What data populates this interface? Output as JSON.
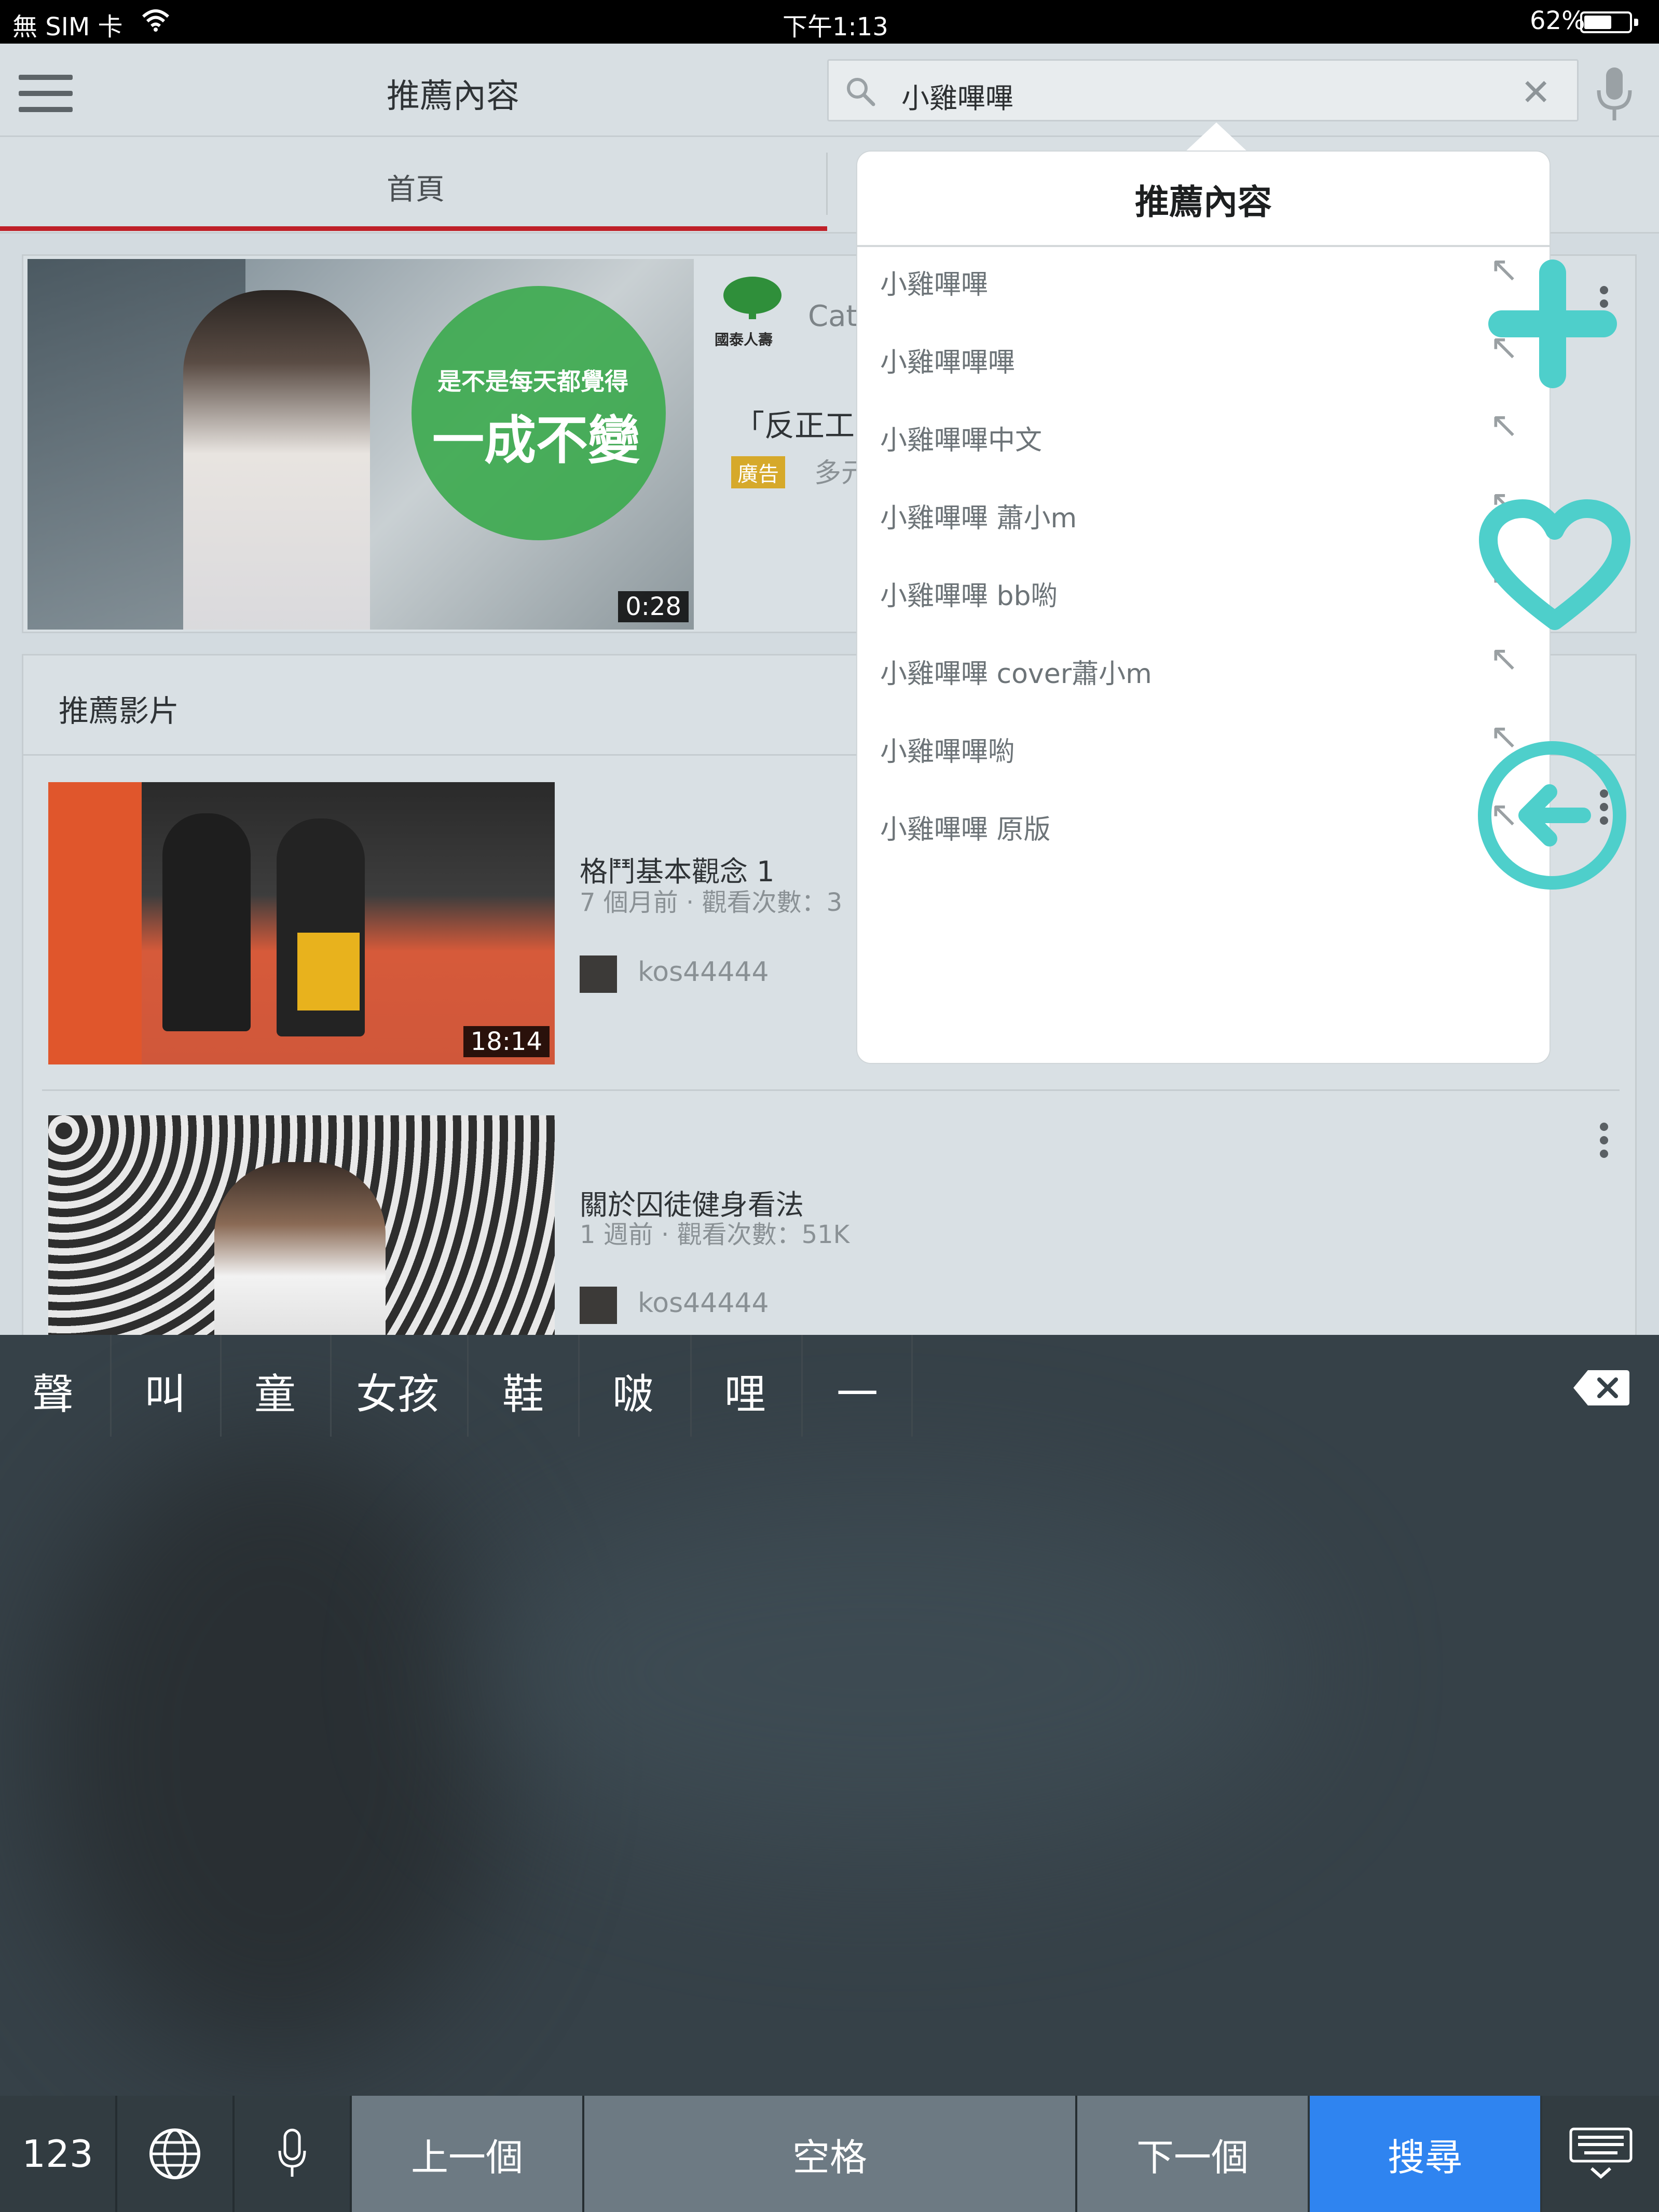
{
  "status_bar": {
    "carrier": "無 SIM 卡",
    "time": "下午1:13",
    "battery_text": "62%",
    "battery_level": 0.62
  },
  "app_bar": {
    "title": "推薦內容",
    "search_value": "小雞嗶嗶",
    "icons": [
      "menu-icon",
      "search-icon",
      "clear-icon",
      "microphone-icon"
    ]
  },
  "tabs": {
    "home": "首頁"
  },
  "ad_card": {
    "duration": "0:28",
    "thumb_line1": "是不是每天都覺得",
    "thumb_line2": "一成不變",
    "advertiser_logo_text": "國泰人壽",
    "advertiser_truncated": "Cath",
    "title_truncated": "「反正工",
    "ad_badge": "廣告",
    "desc_truncated": "多元"
  },
  "recommended": {
    "heading": "推薦影片",
    "videos": [
      {
        "title": "格鬥基本觀念 1",
        "meta": "7 個月前 · 觀看次數：3",
        "channel": "kos44444",
        "duration": "18:14"
      },
      {
        "title": "關於囚徒健身看法",
        "meta": "1 週前 · 觀看次數：51K",
        "channel": "kos44444"
      }
    ]
  },
  "suggestions": {
    "title": "推薦內容",
    "items": [
      "小雞嗶嗶",
      "小雞嗶嗶嗶",
      "小雞嗶嗶中文",
      "小雞嗶嗶 蕭小m",
      "小雞嗶嗶 bb喲",
      "小雞嗶嗶 cover蕭小m",
      "小雞嗶嗶喲",
      "小雞嗶嗶 原版"
    ],
    "fill_icon": "arrow-up-left-icon"
  },
  "overlay_icons": [
    "plus-icon",
    "heart-icon",
    "back-arrow-circle-icon"
  ],
  "overlay_color": "#4ecfcb",
  "keyboard": {
    "candidates": [
      "聲",
      "叫",
      "童",
      "女孩",
      "鞋",
      "啵",
      "哩",
      "一"
    ],
    "keys": {
      "numbers": "123",
      "prev": "上一個",
      "space": "空格",
      "next": "下一個",
      "search": "搜尋"
    },
    "search_color": "#2f84f0"
  }
}
